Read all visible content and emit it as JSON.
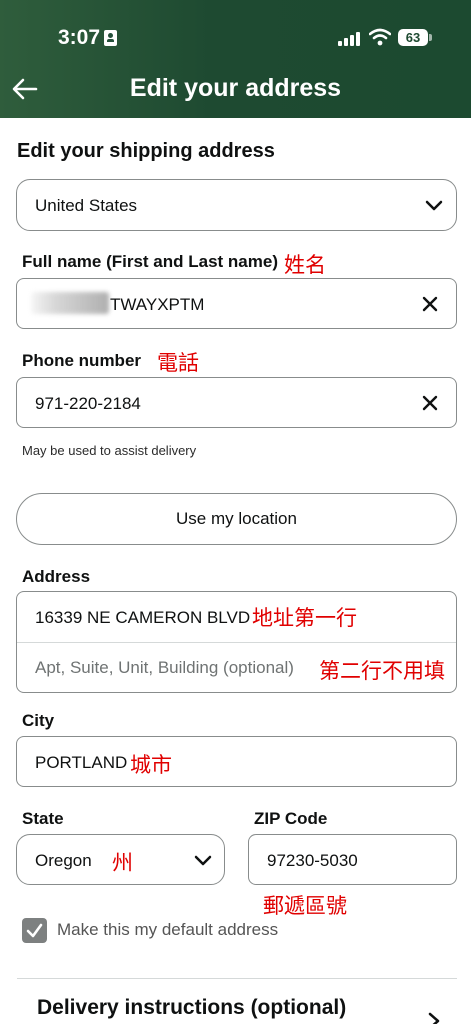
{
  "status_bar": {
    "time": "3:07",
    "battery": "63"
  },
  "header": {
    "title": "Edit your address"
  },
  "form": {
    "section_title": "Edit your shipping address",
    "country": "United States",
    "full_name": {
      "label": "Full name (First and Last name)",
      "value": "TWAYXPTM",
      "note": "姓名"
    },
    "phone": {
      "label": "Phone number",
      "value": "971-220-2184",
      "note": "電話",
      "hint": "May be used to assist delivery"
    },
    "use_location_label": "Use my location",
    "address": {
      "label": "Address",
      "line1": "16339 NE CAMERON BLVD",
      "line1_note": "地址第一行",
      "line2_placeholder": "Apt, Suite, Unit, Building (optional)",
      "line2_note": "第二行不用填"
    },
    "city": {
      "label": "City",
      "value": "PORTLAND",
      "note": "城市"
    },
    "state": {
      "label": "State",
      "value": "Oregon",
      "note": "州"
    },
    "zip": {
      "label": "ZIP Code",
      "value": "97230-5030",
      "note": "郵遞區號"
    },
    "default_address": {
      "label": "Make this my default address",
      "checked": true
    },
    "delivery_instructions": "Delivery instructions (optional)"
  },
  "colors": {
    "header_green": "#1e4a31",
    "annotation_red": "#e00000",
    "border": "#888c8c"
  }
}
